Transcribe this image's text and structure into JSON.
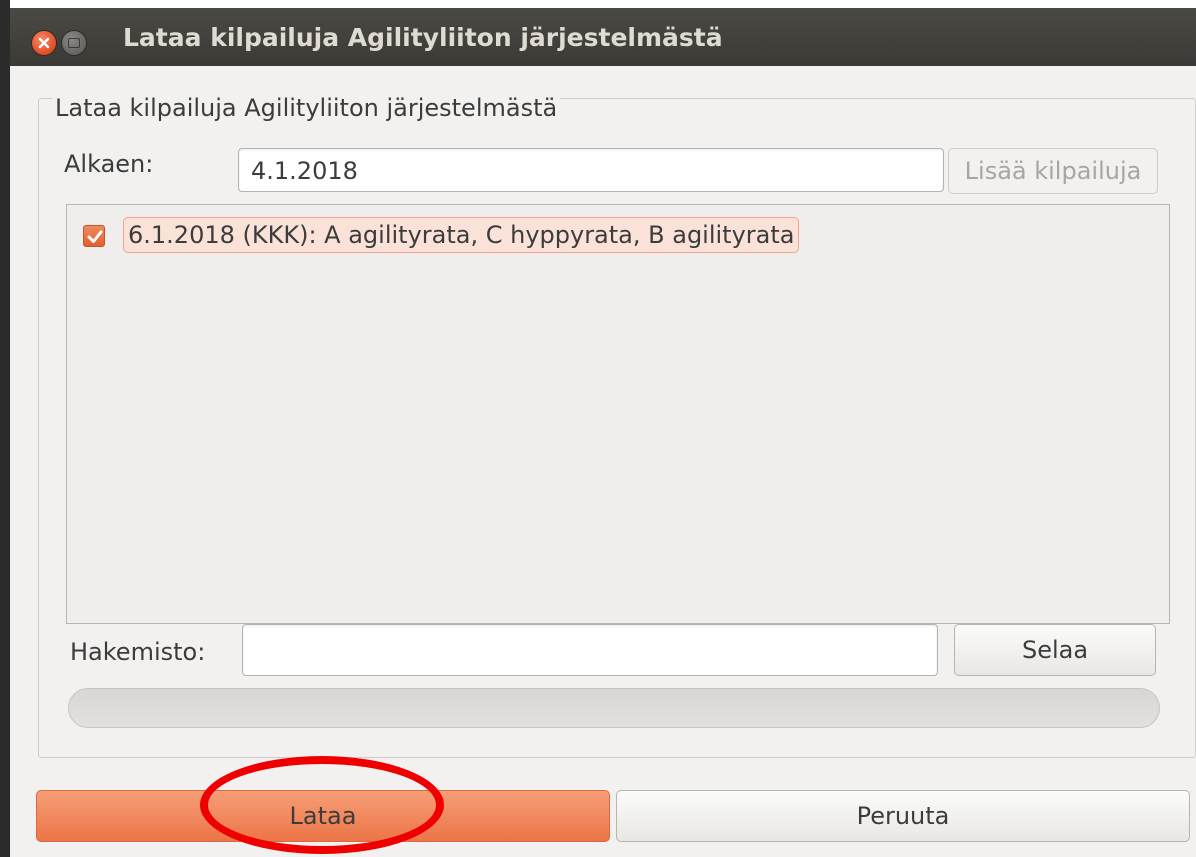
{
  "window": {
    "title": "Lataa kilpailuja Agilityliiton järjestelmästä"
  },
  "group": {
    "title": "Lataa kilpailuja Agilityliiton järjestelmästä"
  },
  "start": {
    "label": "Alkaen:",
    "value": "4.1.2018",
    "add_button": "Lisää kilpailuja",
    "add_button_enabled": false
  },
  "competitions": [
    {
      "label": "6.1.2018 (KKK): A agilityrata, C hyppyrata, B agilityrata",
      "checked": true
    }
  ],
  "directory": {
    "label": "Hakemisto:",
    "value": "",
    "browse_button": "Selaa"
  },
  "progress": {
    "value": 0
  },
  "actions": {
    "load": "Lataa",
    "cancel": "Peruuta"
  },
  "colors": {
    "accent": "#ec7547",
    "titlebar": "#3c3b37",
    "annotation": "#ee0000"
  }
}
